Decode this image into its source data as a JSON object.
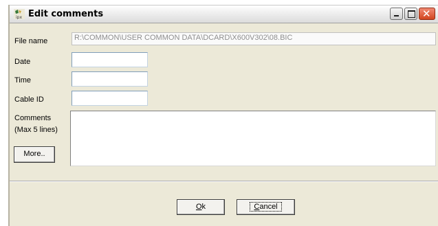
{
  "window": {
    "title": "Edit comments",
    "icon_name": "ipx-app-icon",
    "controls": {
      "minimize": "minimize-icon",
      "maximize": "maximize-icon",
      "close": "close-icon"
    }
  },
  "form": {
    "file_name_label": "File name",
    "file_name_value": "R:\\COMMON\\USER COMMON DATA\\DCARD\\X600V302\\08.BIC",
    "date_label": "Date",
    "date_value": "",
    "time_label": "Time",
    "time_value": "",
    "cable_id_label": "Cable ID",
    "cable_id_value": "",
    "comments_label": "Comments",
    "comments_sublabel": "(Max 5 lines)",
    "comments_value": "",
    "more_button": "More.."
  },
  "footer": {
    "ok_accel": "O",
    "ok_rest": "k",
    "cancel_accel": "C",
    "cancel_rest": "ancel"
  },
  "colors": {
    "face": "#ece9d8",
    "close_red": "#d2451f"
  }
}
